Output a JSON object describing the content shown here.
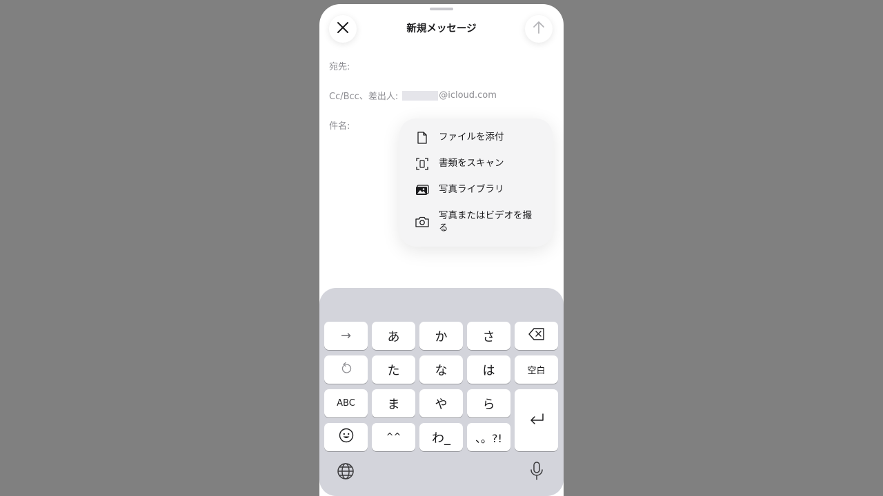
{
  "compose": {
    "title": "新規メッセージ",
    "to_label": "宛先:",
    "cc_label": "Cc/Bcc、差出人:",
    "from_domain": "@icloud.com",
    "subject_label": "件名:"
  },
  "attach_menu": {
    "items": [
      {
        "label": "ファイルを添付",
        "icon": "doc-icon"
      },
      {
        "label": "書類をスキャン",
        "icon": "scan-icon"
      },
      {
        "label": "写真ライブラリ",
        "icon": "photo-library-icon"
      },
      {
        "label": "写真またはビデオを撮る",
        "icon": "camera-icon"
      }
    ]
  },
  "keyboard": {
    "row1": [
      "→",
      "あ",
      "か",
      "さ"
    ],
    "row2": [
      "た",
      "な",
      "は",
      "空白"
    ],
    "row3": [
      "ABC",
      "ま",
      "や",
      "ら"
    ],
    "row4": [
      "^^",
      "わ_",
      "、。?!"
    ]
  },
  "colors": {
    "backdrop": "#808080",
    "sheet": "#ffffff",
    "keyboard_bg": "#d3d4db",
    "menu_bg": "#f4f4f5"
  }
}
